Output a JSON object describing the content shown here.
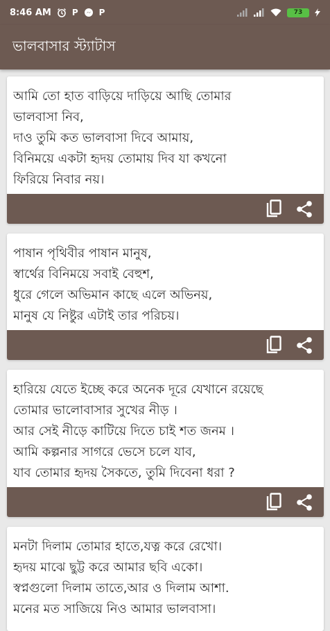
{
  "status_bar": {
    "time": "8:46 AM",
    "notification_icons": [
      "alarm-icon",
      "p-icon",
      "messenger-icon",
      "p-icon"
    ],
    "battery": "73"
  },
  "app_bar": {
    "title": "ভালবাসার স্ট্যাটাস"
  },
  "cards": [
    {
      "lines": [
        "আমি তো হাত বাড়িয়ে দাড়িয়ে আছি তোমার",
        "ভালবাসা নিব,",
        "দাও তুমি কত ভালবাসা দিবে আমায়,",
        "বিনিময়ে একটা হৃদয় তোমায় দিব যা কখনো",
        "ফিরিয়ে নিবার নয়।"
      ]
    },
    {
      "lines": [
        "পাষান পৃথিবীর পাষান মানুষ,",
        "স্বার্থের বিনিময়ে সবাই বেহুশ,",
        "ধুরে গেলে অভিমান কাছে এলে অভিনয়,",
        "মানুষ যে নিষ্টুর এটাই তার পরিচয়।"
      ]
    },
    {
      "lines": [
        "হারিয়ে যেতে ইচ্ছে করে অনেক দূরে যেখানে রয়েছে",
        "তোমার ভালোবাসার সুখের নীড় ।",
        "আর সেই নীড়ে কাটিয়ে দিতে চাই শত জনম ।",
        "আমি কল্পনার সাগরে ভেসে চলে যাব,",
        "যাব তোমার হৃদয় সৈকতে, তুমি দিবেনা ধরা ?"
      ]
    },
    {
      "lines": [
        "মনটা দিলাম তোমার হাতে,যত্ন করে রেখো।",
        "হৃদয় মাঝে ছুট্ট করে আমার ছবি একো।",
        "স্বপ্নগুলো দিলাম তাতে,আর ও দিলাম আশা.",
        "মনের মত সাজিয়ে নিও আমার ভালবাসা।"
      ]
    }
  ],
  "colors": {
    "primary": "#6d5a52",
    "background": "#e9e9e9",
    "card": "#ffffff",
    "text": "#333333"
  },
  "actions": {
    "copy_icon": "copy-icon",
    "share_icon": "share-icon"
  }
}
